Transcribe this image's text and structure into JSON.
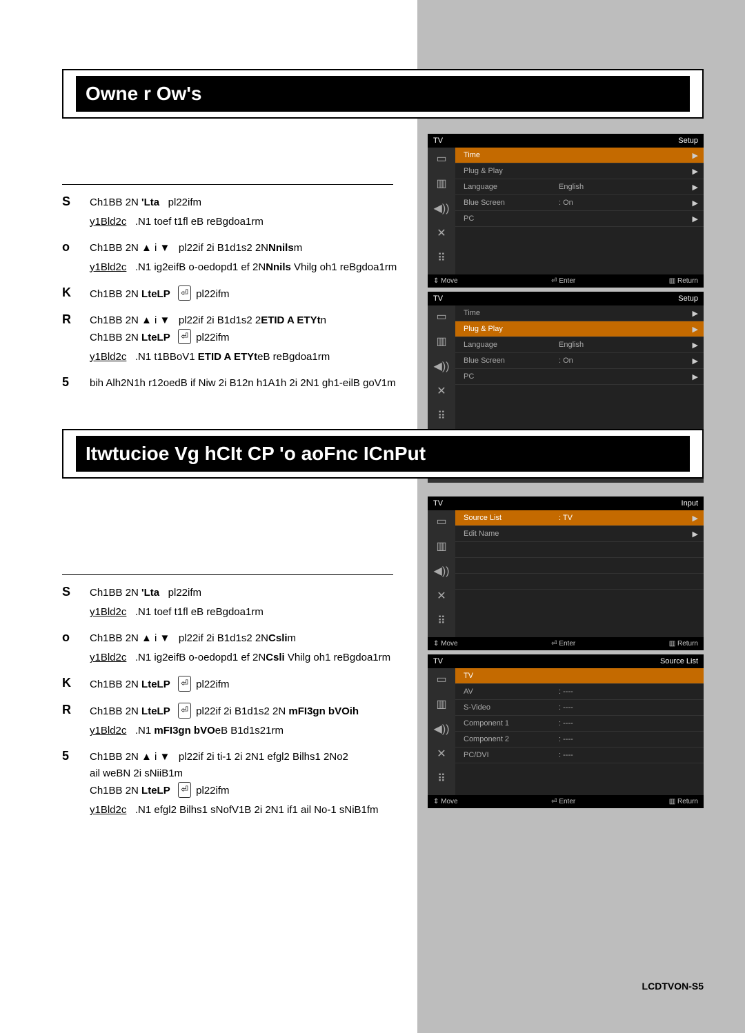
{
  "section1": {
    "title": "Owne r Ow's"
  },
  "section2": {
    "title": "Itwtucioe Vg hCIt CP 'o aoFnc ICnPut"
  },
  "enter_glyph": "⏎",
  "steps1": {
    "s1_num": "S",
    "s1_l1a": "Ch1BB 2N",
    "s1_l1b": "'Lta",
    "s1_l1c": "pl22ifm",
    "s1_res_lbl": "y1Bld2c",
    "s1_res_txt": ".N1 toef t1fl eB reBgdoa1rm",
    "s2_num": "o",
    "s2_l1a": "Ch1BB 2N ▲ i ▼",
    "s2_l1b": "pl22if 2i B1d1s2 2N",
    "s2_bold": "Nnils",
    "s2_l1c": "m",
    "s2_res_lbl": "y1Bld2c",
    "s2_res_txt_a": ".N1 ig2eifB o-oedopd1 ef 2N",
    "s2_res_bold": "Nnils",
    "s2_res_txt_b": " Vhilg oh1 reBgdoa1rm",
    "s3_num": "K",
    "s3_l1a": "Ch1BB 2N",
    "s3_l1_bold": "LteLP",
    "s3_l1b": "pl22ifm",
    "s4_num": "R",
    "s4_l1a": "Ch1BB 2N ▲ i ▼",
    "s4_l1b": "pl22if 2i B1d1s2 2",
    "s4_l1_bold": "ETID A ETYt",
    "s4_l1c": "n",
    "s4_l2a": "Ch1BB 2N",
    "s4_l2_bold": "LteLP",
    "s4_l2b": "pl22ifm",
    "s4_res_lbl": "y1Bld2c",
    "s4_res_txt_a": ".N1 t1BBoV1 ",
    "s4_res_bold": "ETID A ETYt",
    "s4_res_txt_b": "eB reBgdoa1rm",
    "s5_num": "5",
    "s5_txt": "bih Alh2N1h r12oedB if Niw 2i B12n h1A1h 2i 2N1 gh1-eilB goV1m"
  },
  "steps2": {
    "s1_num": "S",
    "s1_l1a": "Ch1BB 2N",
    "s1_l1b": "'Lta",
    "s1_l1c": "pl22ifm",
    "s1_res_lbl": "y1Bld2c",
    "s1_res_txt": ".N1 toef t1fl eB reBgdoa1rm",
    "s2_num": "o",
    "s2_l1a": "Ch1BB 2N ▲ i ▼",
    "s2_l1b": "pl22if 2i B1d1s2 2N",
    "s2_bold": "Csli",
    "s2_l1c": "m",
    "s2_res_lbl": "y1Bld2c",
    "s2_res_txt_a": ".N1 ig2eifB o-oedopd1 ef 2N",
    "s2_res_bold": "Csli",
    "s2_res_txt_b": " Vhilg oh1 reBgdoa1rm",
    "s3_num": "K",
    "s3_l1a": "Ch1BB 2N",
    "s3_l1_bold": "LteLP",
    "s3_l1b": "pl22ifm",
    "s4_num": "R",
    "s4_l1a": "Ch1BB 2N",
    "s4_l1_bold": "LteLP",
    "s4_l1b": "pl22if 2i B1d1s2 2N",
    "s4_l1_bold2": "mFI3gn bVOih",
    "s4_res_lbl": "y1Bld2c",
    "s4_res_txt_a": ".N1 ",
    "s4_res_bold": "mFI3gn bVO",
    "s4_res_txt_b": "eB B1d1s21rm",
    "s5_num": "5",
    "s5_l1a": "Ch1BB 2N ▲ i ▼",
    "s5_l1b": "pl22if 2i ti-1 2i 2N1 efgl2 Bilhs1 2No2",
    "s5_l2": "ail weBN 2i sNiiB1m",
    "s5_l3a": "Ch1BB 2N",
    "s5_l3_bold": "LteLP",
    "s5_l3b": "pl22ifm",
    "s5_res_lbl": "y1Bld2c",
    "s5_res_txt": ".N1 efgl2 Bilhs1 sNofV1B 2i 2N1 if1 ail No-1 sNiB1fm"
  },
  "osd": {
    "head_tv": "TV",
    "head_setup": "Setup",
    "head_input": "Input",
    "head_srclist": "Source List",
    "foot_move": "⇕ Move",
    "foot_enter": "⏎ Enter",
    "foot_return": "▥ Return",
    "setup_rows": {
      "time": "Time",
      "plugplay": "Plug & Play",
      "language": "Language",
      "language_val": "English",
      "bluescreen": "Blue Screen",
      "bluescreen_val": ": On",
      "pc": "PC"
    },
    "plugplay_box": "Plug & Play",
    "input_rows": {
      "srclist": "Source List",
      "srclist_val": ": TV",
      "editname": "Edit Name"
    },
    "srclist_rows": {
      "tv": "TV",
      "av": "AV",
      "svideo": "S-Video",
      "comp1": "Component 1",
      "comp2": "Component 2",
      "pcdvi": "PC/DVI",
      "dash": ": ----"
    }
  },
  "footnote": "LCDTVON-S5"
}
